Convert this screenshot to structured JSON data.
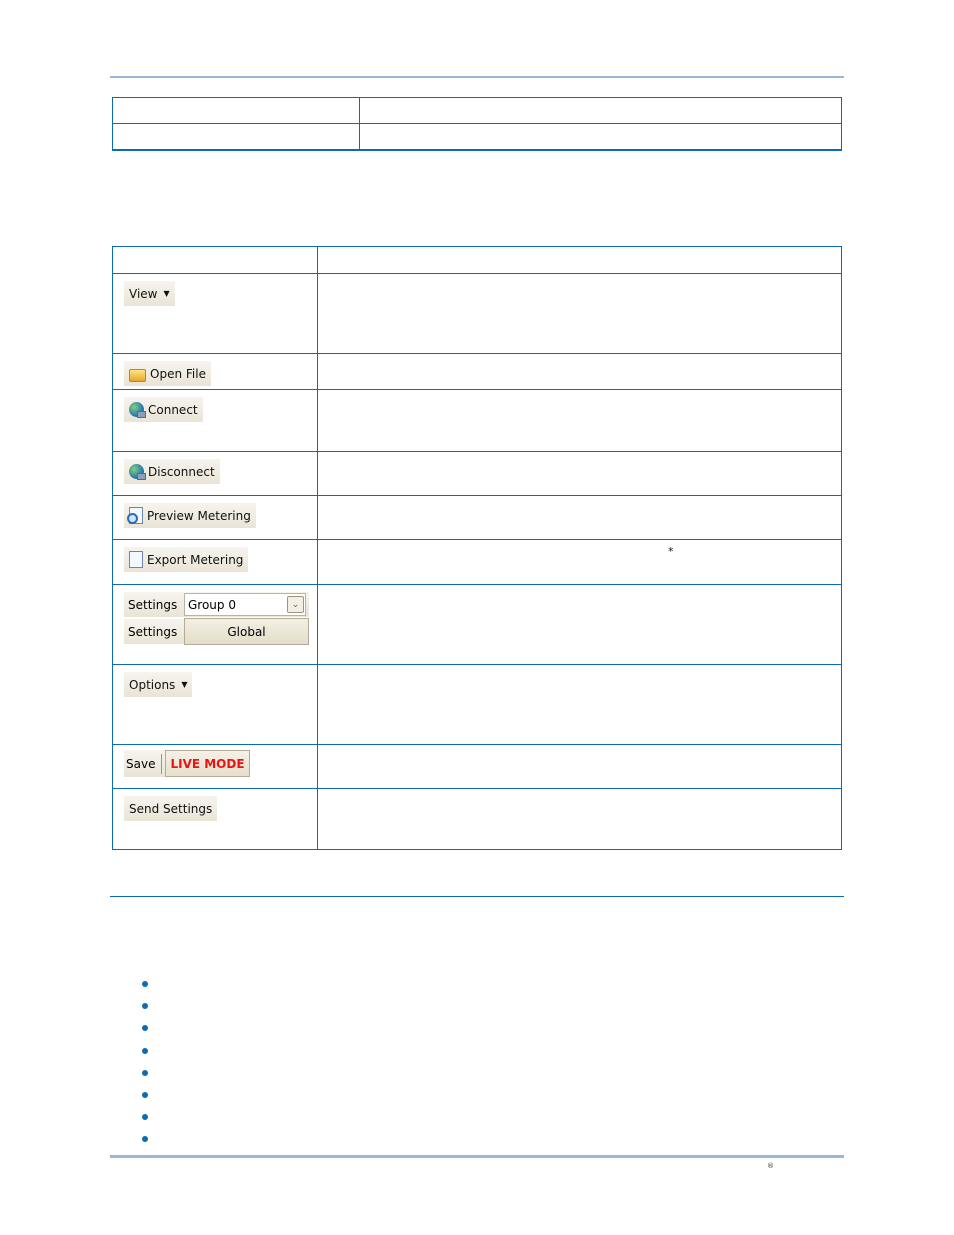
{
  "colors": {
    "rule": "#0b6cb2",
    "rule_light": "#9ab7d6",
    "bullet": "#0b6cb2",
    "live_mode": "#ee1111"
  },
  "top_table": {
    "rows": 2,
    "columns": 2
  },
  "toolbar_table": {
    "rows": [
      {
        "control": "view-menu",
        "label": "View",
        "icon": "caret-down-icon"
      },
      {
        "control": "open-file-button",
        "label": "Open File",
        "icon": "folder-icon"
      },
      {
        "control": "connect-button",
        "label": "Connect",
        "icon": "globe-icon"
      },
      {
        "control": "disconnect-button",
        "label": "Disconnect",
        "icon": "globe-icon"
      },
      {
        "control": "preview-metering-button",
        "label": "Preview Metering",
        "icon": "preview-icon"
      },
      {
        "control": "export-metering-button",
        "label": "Export Metering",
        "icon": "document-icon",
        "note_marker": "*"
      },
      {
        "control": "settings-group",
        "row1_label": "Settings",
        "row1_value": "Group 0",
        "row2_label": "Settings",
        "row2_value": "Global"
      },
      {
        "control": "options-menu",
        "label": "Options",
        "icon": "caret-down-icon"
      },
      {
        "control": "save-live-mode",
        "save_label": "Save",
        "live_label": "LIVE MODE"
      },
      {
        "control": "send-settings-button",
        "label": "Send Settings"
      }
    ]
  },
  "bullet_list": {
    "count": 8
  },
  "footer": {
    "registered_mark": "®"
  }
}
